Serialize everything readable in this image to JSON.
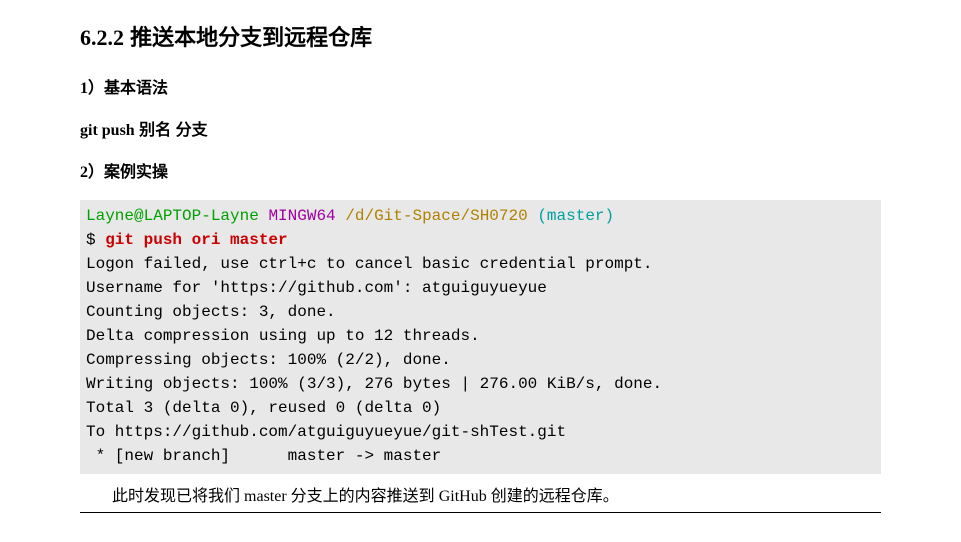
{
  "heading": {
    "number": "6.2.2",
    "title": "推送本地分支到远程仓库"
  },
  "sub1": {
    "number": "1）",
    "title": "基本语法"
  },
  "syntax": {
    "cmd": "git push",
    "args": " 别名 分支"
  },
  "sub2": {
    "number": "2）",
    "title": "案例实操"
  },
  "terminal": {
    "prompt_user": "Layne@LAPTOP-Layne",
    "prompt_host": "MINGW64",
    "prompt_path": "/d/Git-Space/SH0720",
    "prompt_branch": "(master)",
    "dollar": "$ ",
    "command": "git push ori master",
    "line1": "Logon failed, use ctrl+c to cancel basic credential prompt.",
    "line2": "Username for 'https://github.com': atguiguyueyue",
    "line3": "Counting objects: 3, done.",
    "line4": "Delta compression using up to 12 threads.",
    "line5": "Compressing objects: 100% (2/2), done.",
    "line6": "Writing objects: 100% (3/3), 276 bytes | 276.00 KiB/s, done.",
    "line7": "Total 3 (delta 0), reused 0 (delta 0)",
    "line8": "To https://github.com/atguiguyueyue/git-shTest.git",
    "line9": " * [new branch]      master -> master"
  },
  "footnote": {
    "pre": "此时发现已将我们 ",
    "mid1": "master",
    "mid2": " 分支上的内容推送到 ",
    "mid3": "GitHub",
    "post": " 创建的远程仓库。"
  }
}
